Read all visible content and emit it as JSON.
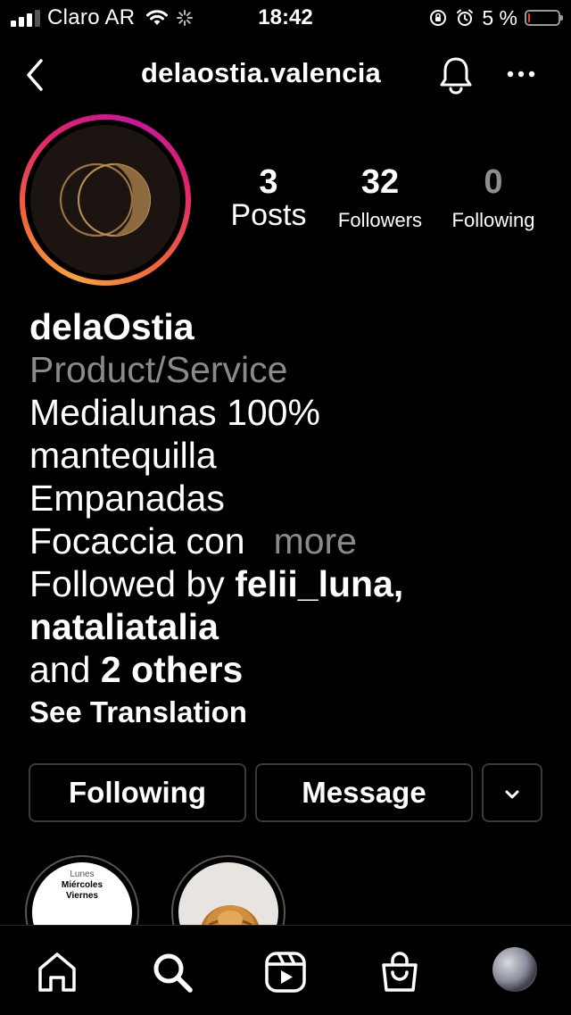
{
  "status_bar": {
    "carrier": "Claro AR",
    "time": "18:42",
    "battery_percent": "5 %",
    "battery_level": 0.05,
    "battery_color": "#ff3b30"
  },
  "header": {
    "username": "delaostia.valencia",
    "icons": [
      "chevron-left-icon",
      "bell-icon",
      "more-horizontal-icon"
    ]
  },
  "profile": {
    "story_ring_colors": [
      "#f9a13a",
      "#e0236f",
      "#c9169a"
    ],
    "stats": {
      "posts": {
        "value": "3",
        "label": "Posts"
      },
      "followers": {
        "value": "32",
        "label": "Followers"
      },
      "following": {
        "value": "0",
        "label": "Following"
      }
    },
    "display_name": "delaOstia",
    "category": "Product/Service",
    "bio_lines": [
      "Medialunas 100%",
      "mantequilla",
      "Empanadas",
      "Focaccia con"
    ],
    "more_label": "more",
    "followed_by": {
      "prefix": "Followed by",
      "user1": "felii_luna,",
      "user2": "nataliatalia",
      "and": "and",
      "others": "2 others"
    },
    "see_translation": "See Translation"
  },
  "actions": {
    "following_label": "Following",
    "message_label": "Message"
  },
  "highlights": [
    {
      "lines": [
        "Lunes",
        "Miércoles",
        "Viernes"
      ]
    },
    {
      "lines": []
    }
  ],
  "tab_bar": {
    "tabs": [
      "home-icon",
      "search-icon",
      "reels-icon",
      "shop-icon",
      "profile-avatar"
    ]
  }
}
